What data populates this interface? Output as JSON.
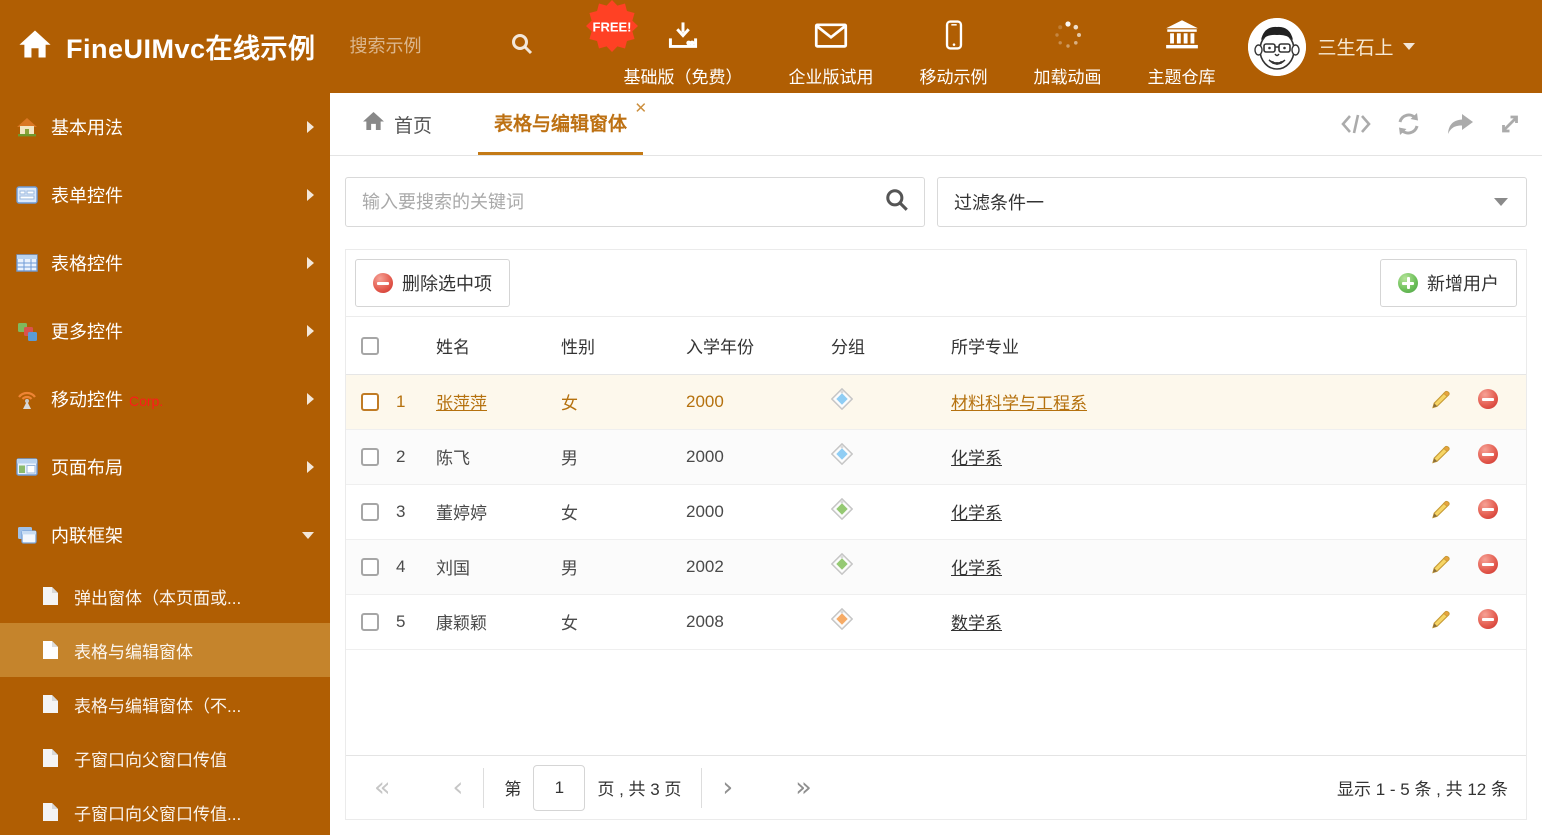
{
  "header": {
    "logo_text": "FineUIMvc在线示例",
    "search_placeholder": "搜索示例",
    "free_badge": "FREE!",
    "nav_items": [
      {
        "icon": "download-icon",
        "label": "基础版（免费）"
      },
      {
        "icon": "envelope-icon",
        "label": "企业版试用"
      },
      {
        "icon": "mobile-icon",
        "label": "移动示例"
      },
      {
        "icon": "spinner-icon",
        "label": "加载动画"
      },
      {
        "icon": "bank-icon",
        "label": "主题仓库"
      }
    ],
    "user_name": "三生石上"
  },
  "sidebar": {
    "items": [
      {
        "label": "基本用法"
      },
      {
        "label": "表单控件"
      },
      {
        "label": "表格控件"
      },
      {
        "label": "更多控件"
      },
      {
        "label": "移动控件",
        "badge": "Corp."
      },
      {
        "label": "页面布局"
      },
      {
        "label": "内联框架"
      }
    ],
    "subitems": [
      {
        "label": "弹出窗体（本页面或..."
      },
      {
        "label": "表格与编辑窗体"
      },
      {
        "label": "表格与编辑窗体（不..."
      },
      {
        "label": "子窗口向父窗口传值"
      },
      {
        "label": "子窗口向父窗口传值..."
      }
    ]
  },
  "tabs": {
    "home": "首页",
    "active": "表格与编辑窗体"
  },
  "filter_bar": {
    "search_placeholder": "输入要搜索的关键词",
    "filter_value": "过滤条件一"
  },
  "toolbar": {
    "delete_label": "删除选中项",
    "add_label": "新增用户"
  },
  "table": {
    "columns": [
      "姓名",
      "性别",
      "入学年份",
      "分组",
      "所学专业"
    ],
    "rows": [
      {
        "num": "1",
        "name": "张萍萍",
        "gender": "女",
        "year": "2000",
        "tag_color": "#8fcdf4",
        "major": "材料科学与工程系",
        "selected": true
      },
      {
        "num": "2",
        "name": "陈飞",
        "gender": "男",
        "year": "2000",
        "tag_color": "#8fcdf4",
        "major": "化学系",
        "selected": false
      },
      {
        "num": "3",
        "name": "董婷婷",
        "gender": "女",
        "year": "2000",
        "tag_color": "#95c973",
        "major": "化学系",
        "selected": false
      },
      {
        "num": "4",
        "name": "刘国",
        "gender": "男",
        "year": "2002",
        "tag_color": "#95c973",
        "major": "化学系",
        "selected": false
      },
      {
        "num": "5",
        "name": "康颖颖",
        "gender": "女",
        "year": "2008",
        "tag_color": "#f6ab66",
        "major": "数学系",
        "selected": false
      }
    ]
  },
  "pagination": {
    "first": "«",
    "prev": "‹",
    "next": "›",
    "last": "»",
    "page_prefix": "第",
    "page_value": "1",
    "page_suffix": "页 , 共 3 页",
    "summary": "显示 1 - 5 条 , 共 12 条"
  },
  "colors": {
    "theme_orange": "#b05e03",
    "active_item_orange": "#c5842c",
    "active_tab_orange": "#bd7113",
    "selected_row_bg": "#fdf8ec",
    "selected_row_text": "#b5710e",
    "danger_red": "#d9534f",
    "success_green": "#5cb85c",
    "corp_red": "#ff1a1a"
  }
}
